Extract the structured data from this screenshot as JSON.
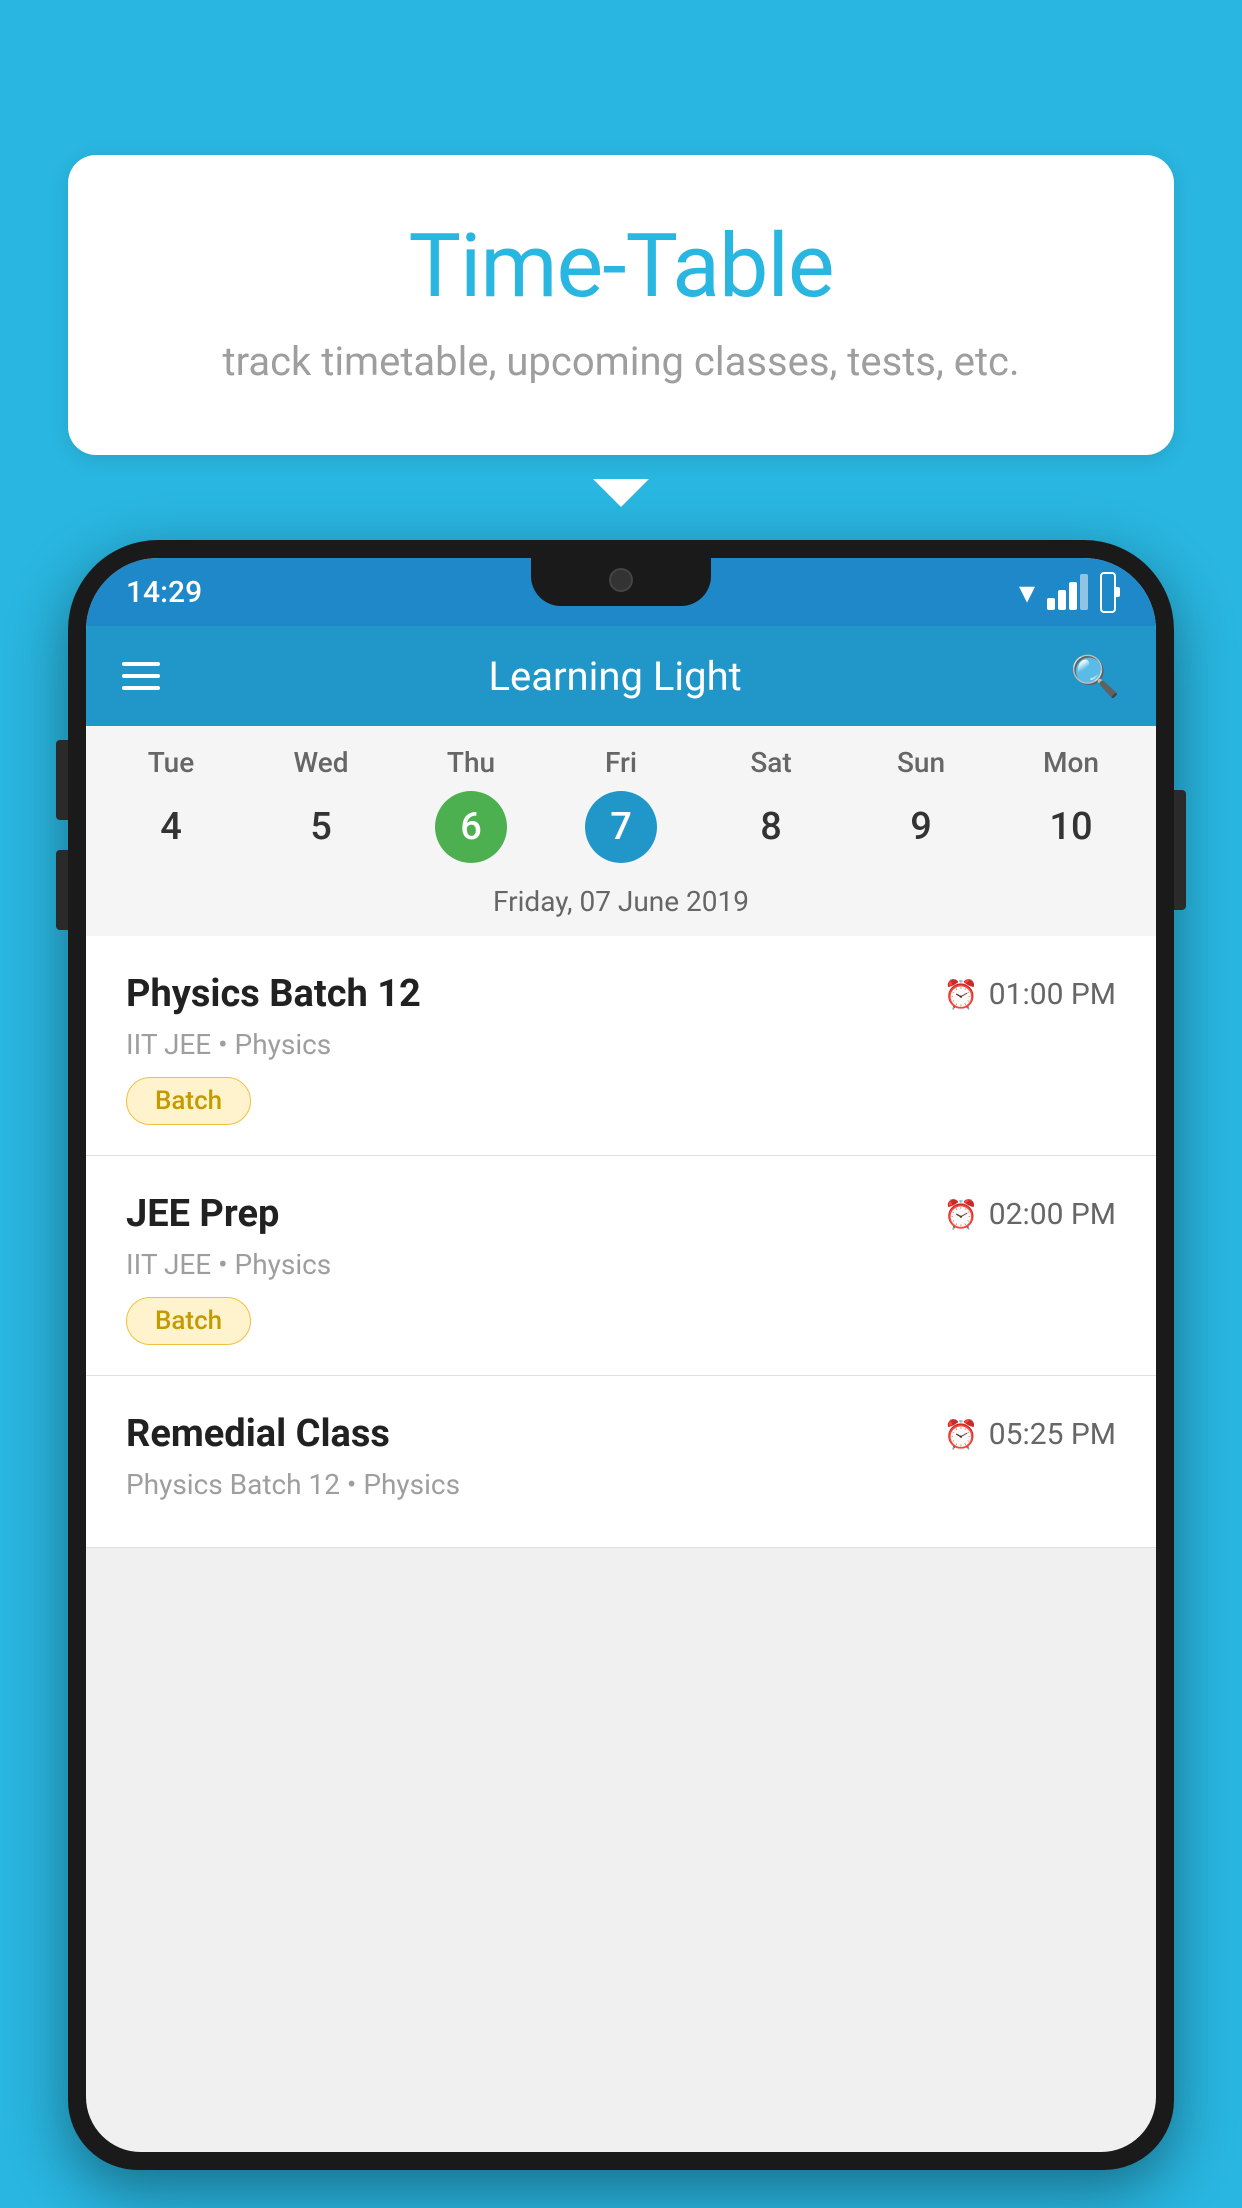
{
  "background_color": "#29b6e0",
  "speech_bubble": {
    "title": "Time-Table",
    "subtitle": "track timetable, upcoming classes, tests, etc."
  },
  "phone": {
    "status_bar": {
      "time": "14:29"
    },
    "app_bar": {
      "title": "Learning Light"
    },
    "calendar": {
      "days": [
        {
          "name": "Tue",
          "num": "4",
          "state": "normal"
        },
        {
          "name": "Wed",
          "num": "5",
          "state": "normal"
        },
        {
          "name": "Thu",
          "num": "6",
          "state": "today"
        },
        {
          "name": "Fri",
          "num": "7",
          "state": "selected"
        },
        {
          "name": "Sat",
          "num": "8",
          "state": "normal"
        },
        {
          "name": "Sun",
          "num": "9",
          "state": "normal"
        },
        {
          "name": "Mon",
          "num": "10",
          "state": "normal"
        }
      ],
      "selected_date_label": "Friday, 07 June 2019"
    },
    "schedule": [
      {
        "title": "Physics Batch 12",
        "time": "01:00 PM",
        "subtitle": "IIT JEE • Physics",
        "badge": "Batch"
      },
      {
        "title": "JEE Prep",
        "time": "02:00 PM",
        "subtitle": "IIT JEE • Physics",
        "badge": "Batch"
      },
      {
        "title": "Remedial Class",
        "time": "05:25 PM",
        "subtitle": "Physics Batch 12 • Physics",
        "badge": null
      }
    ]
  }
}
